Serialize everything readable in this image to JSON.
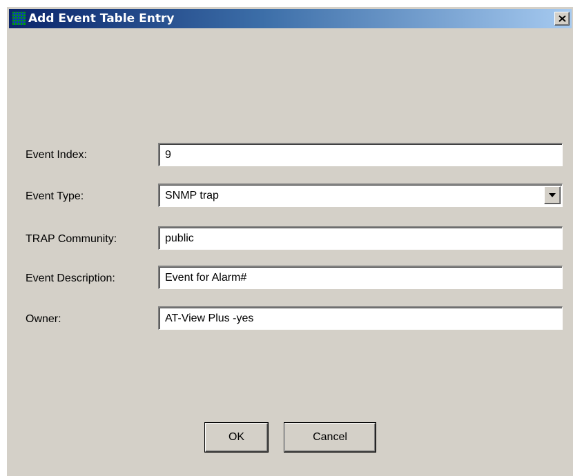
{
  "window": {
    "title": "Add Event Table Entry",
    "icon": "grid-app-icon",
    "close_icon": "close-icon"
  },
  "form": {
    "event_index": {
      "label": "Event Index:",
      "value": "9"
    },
    "event_type": {
      "label": "Event Type:",
      "value": "SNMP trap",
      "arrow_icon": "chevron-down-icon"
    },
    "trap_community": {
      "label": "TRAP Community:",
      "value": "public"
    },
    "event_description": {
      "label": "Event Description:",
      "value": "Event for Alarm#"
    },
    "owner": {
      "label": "Owner:",
      "value": "AT-View Plus -yes"
    }
  },
  "buttons": {
    "ok_label": "OK",
    "cancel_label": "Cancel"
  },
  "colors": {
    "titlebar_start": "#0a246a",
    "titlebar_end": "#a6caf0",
    "dialog_background": "#d4d0c8",
    "field_background": "#ffffff",
    "icon_green": "#00a000",
    "icon_blue": "#0000c0"
  }
}
